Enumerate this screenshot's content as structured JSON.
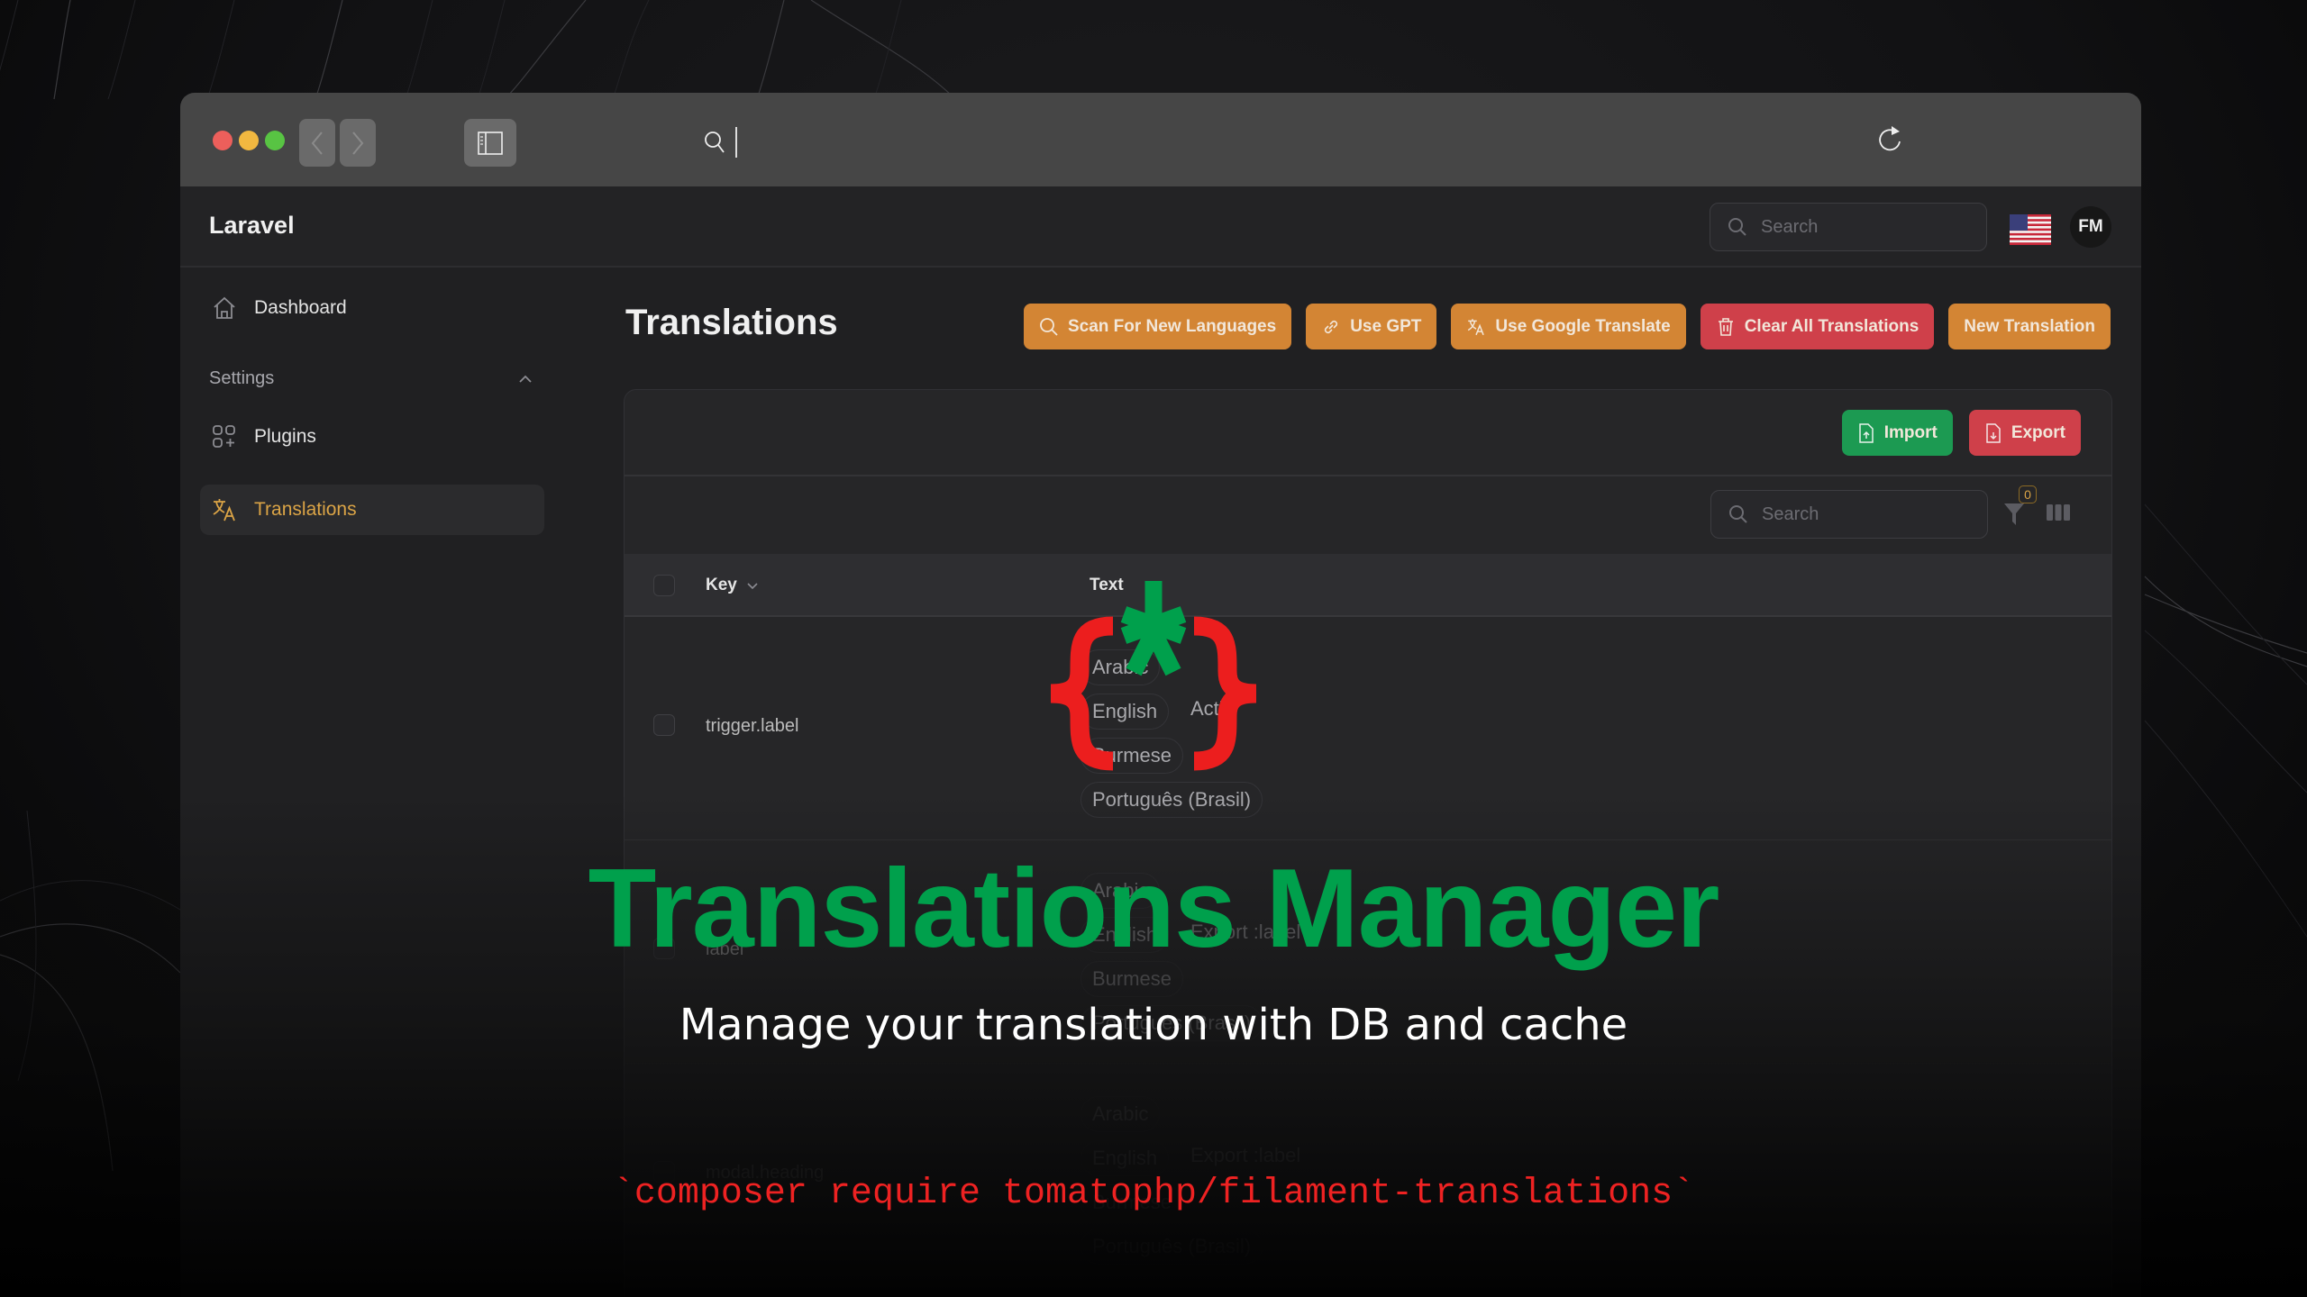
{
  "browser": {
    "traffic_lights": {
      "close": "#ec5f5b",
      "minimize": "#f2b840",
      "maximize": "#58c443"
    },
    "back_icon": "chevron-left-icon",
    "forward_icon": "chevron-right-icon",
    "sidebar_icon": "sidebar-icon",
    "address_icon": "search-icon",
    "reload_icon": "reload-icon",
    "tabs_icon": "tabs-overview-icon"
  },
  "app": {
    "brand": "Laravel",
    "search_placeholder": "Search",
    "locale_flag": "us-flag-icon",
    "user_initials": "FM"
  },
  "sidebar": {
    "items": [
      {
        "label": "Dashboard",
        "icon": "home-icon",
        "active": false
      }
    ],
    "groups": [
      {
        "label": "Settings",
        "expanded": true,
        "items": [
          {
            "label": "Plugins",
            "icon": "plugins-icon",
            "active": false
          },
          {
            "label": "Translations",
            "icon": "language-icon",
            "active": true
          }
        ]
      }
    ]
  },
  "page": {
    "title": "Translations",
    "actions": [
      {
        "label": "Scan For New Languages",
        "icon": "search-icon",
        "color": "#d38534"
      },
      {
        "label": "Use GPT",
        "icon": "link-icon",
        "color": "#d38534"
      },
      {
        "label": "Use Google Translate",
        "icon": "language-icon",
        "color": "#d38534"
      },
      {
        "label": "Clear All Translations",
        "icon": "trash-icon",
        "color": "#cf404a"
      },
      {
        "label": "New Translation",
        "icon": "",
        "color": "#d38534"
      }
    ]
  },
  "table": {
    "header_actions": [
      {
        "label": "Import",
        "icon": "file-upload-icon",
        "color": "#1c9a52"
      },
      {
        "label": "Export",
        "icon": "file-download-icon",
        "color": "#cf404a"
      }
    ],
    "search_placeholder": "Search",
    "filter_count": "0",
    "columns": [
      {
        "label": "Key",
        "sortable": true
      },
      {
        "label": "Text"
      }
    ],
    "rows": [
      {
        "key": "trigger.label",
        "languages": [
          "Arabic",
          "English",
          "Burmese",
          "Português (Brasil)"
        ],
        "value": "Actio"
      },
      {
        "key": "label",
        "languages": [
          "Arabic",
          "English",
          "Burmese",
          "Português (Brasil)"
        ],
        "value": "Export :label"
      },
      {
        "key": "modal.heading",
        "languages": [
          "Arabic",
          "English",
          "Burmese",
          "Português (Brasil)"
        ],
        "value": "Export :label"
      }
    ]
  },
  "overlay": {
    "logo_icon": "braces-asterisk-logo-icon",
    "headline": "Translations Manager",
    "subheadline": "Manage your translation with DB and cache",
    "install_command": "`composer require tomatophp/filament-translations`",
    "colors": {
      "green": "#00a04c",
      "red": "#ee2222"
    }
  }
}
